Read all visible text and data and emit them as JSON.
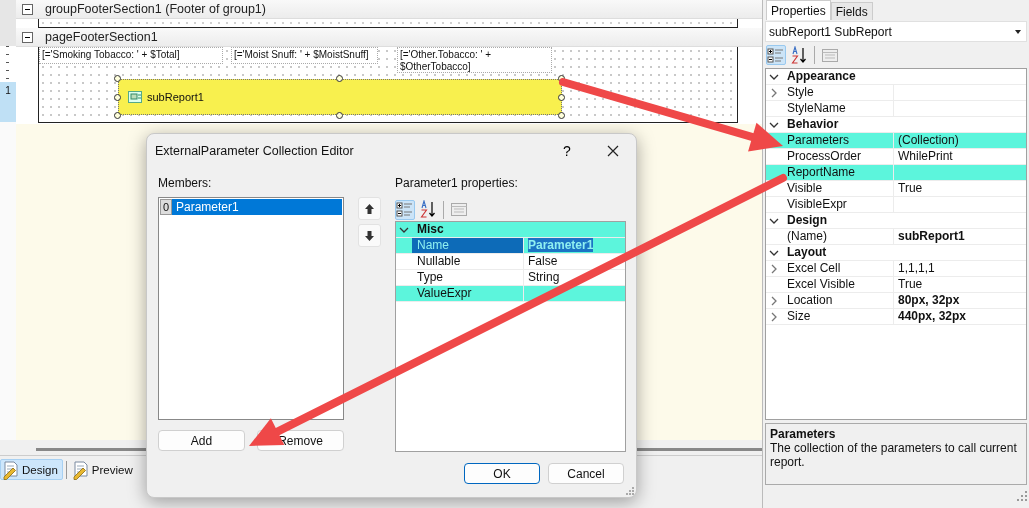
{
  "designer": {
    "sections": [
      {
        "title": "groupFooterSection1 (Footer of group1)",
        "expanded": true
      },
      {
        "title": "pageFooterSection1",
        "expanded": true
      }
    ],
    "ruler_mark": "1",
    "fields": [
      {
        "text": "[='Smoking Tobacco: ' + $Total]"
      },
      {
        "text": "[='Moist Snuff: ' + $MoistSnuff]"
      },
      {
        "text": "[='Other.Tobacco: ' +\n$OtherTobacco]"
      }
    ],
    "subreport": {
      "label": "subReport1",
      "selected": true
    }
  },
  "view_tabs": [
    {
      "label": "Design",
      "selected": true
    },
    {
      "label": "Preview",
      "selected": false
    }
  ],
  "properties": {
    "tabs": [
      {
        "label": "Properties",
        "selected": true
      },
      {
        "label": "Fields",
        "selected": false
      }
    ],
    "object": "subReport1 SubReport",
    "categorized": true,
    "categories": [
      {
        "name": "Appearance",
        "expanded": true,
        "rows": [
          {
            "name": "Style",
            "expandable": true,
            "highlighted": false,
            "selected": false
          },
          {
            "name": "StyleName",
            "expandable": false,
            "highlighted": false,
            "selected": false
          }
        ]
      },
      {
        "name": "Behavior",
        "expanded": true,
        "rows": [
          {
            "name": "Parameters",
            "value": "(Collection)",
            "expandable": false,
            "highlighted": true,
            "modified": false,
            "selected": false
          },
          {
            "name": "ProcessOrder",
            "value": "WhilePrint",
            "expandable": false,
            "highlighted": false,
            "modified": false,
            "selected": false
          },
          {
            "name": "ReportName",
            "expandable": false,
            "highlighted": true,
            "selected": false
          },
          {
            "name": "Visible",
            "value": "True",
            "expandable": false,
            "highlighted": false,
            "modified": false,
            "selected": false
          },
          {
            "name": "VisibleExpr",
            "expandable": false,
            "highlighted": false,
            "selected": false
          }
        ]
      },
      {
        "name": "Design",
        "expanded": true,
        "rows": [
          {
            "name": "(Name)",
            "value": "subReport1",
            "expandable": false,
            "highlighted": false,
            "modified": true,
            "selected": false
          }
        ]
      },
      {
        "name": "Layout",
        "expanded": true,
        "rows": [
          {
            "name": "Excel Cell",
            "value": "1,1,1,1",
            "expandable": true,
            "highlighted": false,
            "modified": false,
            "selected": false
          },
          {
            "name": "Excel Visible",
            "value": "True",
            "expandable": false,
            "highlighted": false,
            "modified": false,
            "selected": false
          },
          {
            "name": "Location",
            "value": "80px, 32px",
            "expandable": true,
            "highlighted": false,
            "modified": true,
            "selected": false
          },
          {
            "name": "Size",
            "value": "440px, 32px",
            "expandable": true,
            "highlighted": false,
            "modified": true,
            "selected": false
          }
        ]
      }
    ],
    "description": {
      "title": "Parameters",
      "text": "The collection of the parameters to call current report."
    }
  },
  "dialog": {
    "title": "ExternalParameter Collection Editor",
    "help": "?",
    "members_label": "Members:",
    "members": [
      {
        "index": "0",
        "name": "Parameter1",
        "selected": true
      }
    ],
    "add": "Add",
    "remove": "Remove",
    "properties_label": "Parameter1 properties:",
    "categorized": true,
    "categories": [
      {
        "name": "Misc",
        "expanded": true,
        "highlighted": true,
        "rows": [
          {
            "name": "Name",
            "value": "Parameter1",
            "expandable": false,
            "highlighted": true,
            "modified": true,
            "selected": true
          },
          {
            "name": "Nullable",
            "value": "False",
            "expandable": false,
            "highlighted": false,
            "modified": false,
            "selected": false
          },
          {
            "name": "Type",
            "value": "String",
            "expandable": false,
            "highlighted": false,
            "modified": false,
            "selected": false
          },
          {
            "name": "ValueExpr",
            "expandable": false,
            "highlighted": true,
            "selected": false
          }
        ]
      }
    ],
    "ok": "OK",
    "cancel": "Cancel"
  }
}
